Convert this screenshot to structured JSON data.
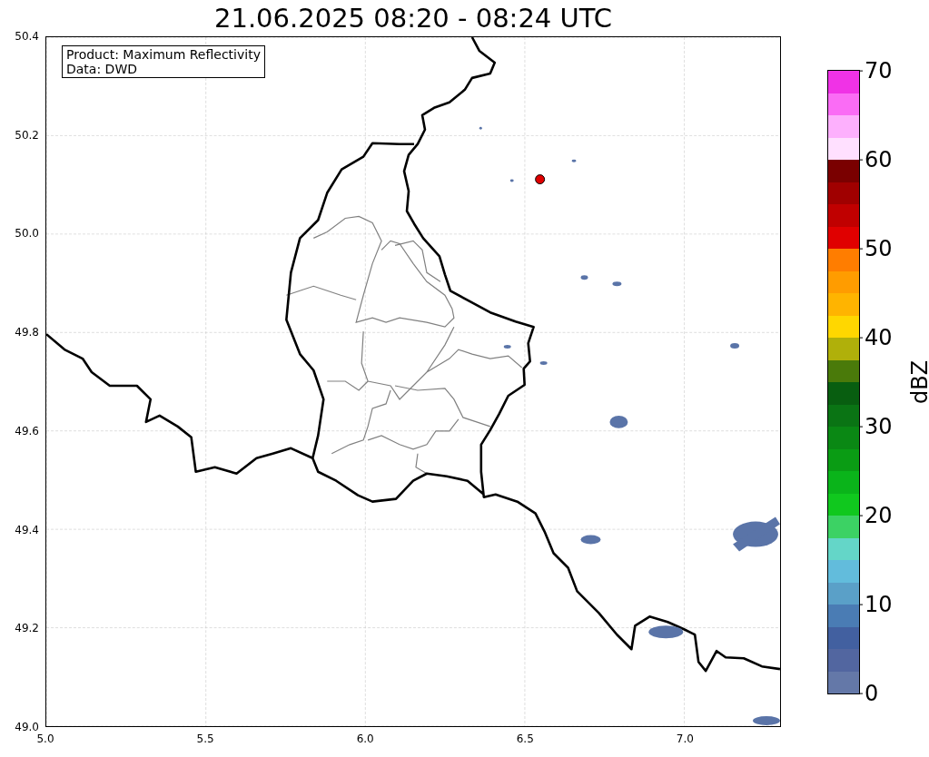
{
  "title": "21.06.2025 08:20 - 08:24 UTC",
  "map": {
    "info_box": [
      "Product: Maximum Reflectivity",
      "Data: DWD"
    ],
    "x_ticks": [
      "5.0",
      "5.5",
      "6.0",
      "6.5",
      "7.0"
    ],
    "y_ticks": [
      "50.4",
      "50.2",
      "50.0",
      "49.8",
      "49.6",
      "49.4",
      "49.2",
      "49.0"
    ]
  },
  "colorbar": {
    "label": "dBZ",
    "ticks": [
      "70",
      "60",
      "50",
      "40",
      "30",
      "20",
      "10",
      "0"
    ],
    "segments": [
      {
        "color": "#6478a8"
      },
      {
        "color": "#5266a0"
      },
      {
        "color": "#4260a0"
      },
      {
        "color": "#4a7cb4"
      },
      {
        "color": "#5aa0c8"
      },
      {
        "color": "#62bcdc"
      },
      {
        "color": "#64d6c8"
      },
      {
        "color": "#3cd264"
      },
      {
        "color": "#10c81e"
      },
      {
        "color": "#0ab41a"
      },
      {
        "color": "#0a9c14"
      },
      {
        "color": "#0a8814"
      },
      {
        "color": "#0a7414"
      },
      {
        "color": "#085e10"
      },
      {
        "color": "#4a7a0a"
      },
      {
        "color": "#b0b00a"
      },
      {
        "color": "#ffd700"
      },
      {
        "color": "#ffb400"
      },
      {
        "color": "#ff9c00"
      },
      {
        "color": "#ff7d00"
      },
      {
        "color": "#e00000"
      },
      {
        "color": "#c00000"
      },
      {
        "color": "#a00000"
      },
      {
        "color": "#7a0000"
      },
      {
        "color": "#ffe0ff"
      },
      {
        "color": "#fdb0fd"
      },
      {
        "color": "#fa6cf5"
      },
      {
        "color": "#f032e6"
      }
    ]
  }
}
